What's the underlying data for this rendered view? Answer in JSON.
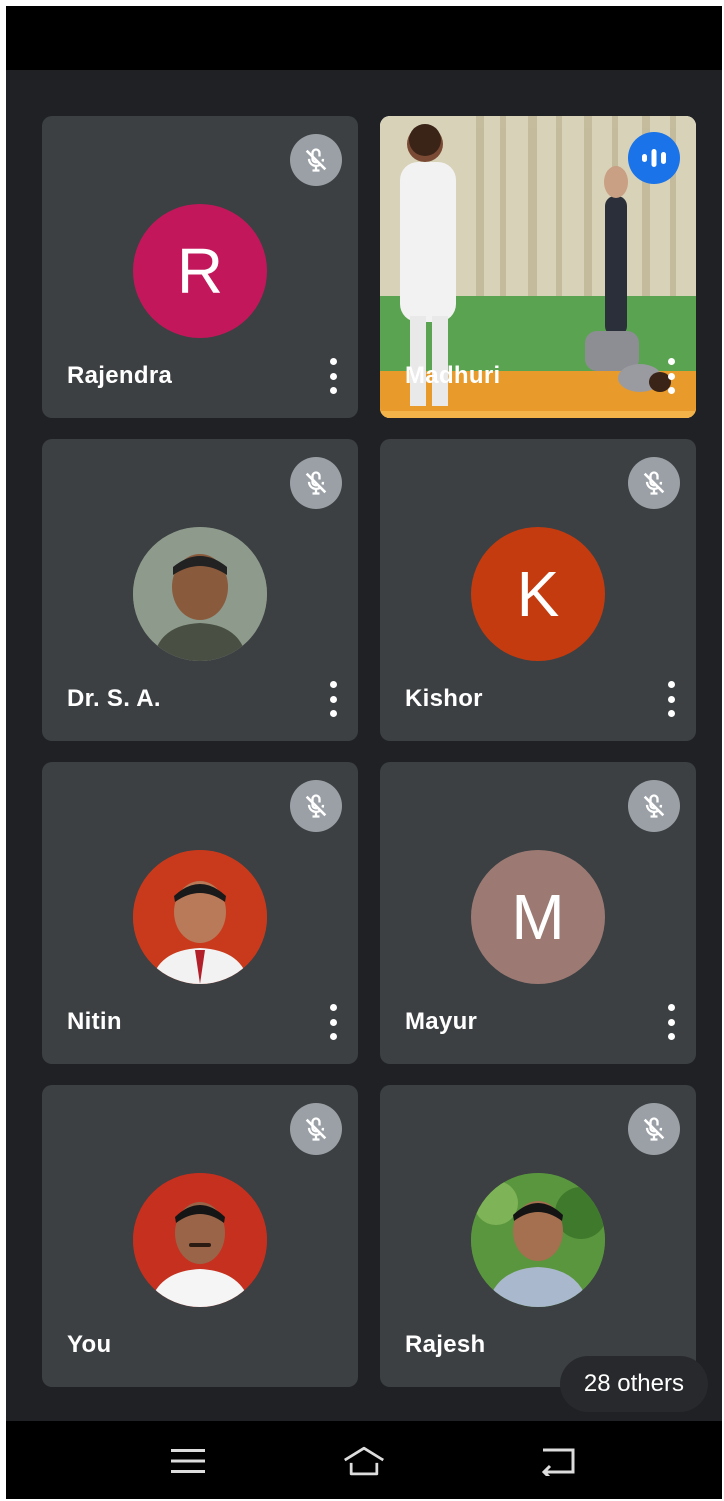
{
  "participants": [
    {
      "name": "Rajendra",
      "initial": "R",
      "color": "#c2185b",
      "muted": true
    },
    {
      "name": "Madhuri",
      "video": true,
      "speaking": true
    },
    {
      "name": "Dr. S. A.",
      "photo": true
    },
    {
      "name": "Kishor",
      "initial": "K",
      "color": "#c43b0f",
      "muted": true
    },
    {
      "name": "Nitin",
      "photo": true
    },
    {
      "name": "Mayur",
      "initial": "M",
      "color": "#9c7a73",
      "muted": true
    },
    {
      "name": "You",
      "photo": true
    },
    {
      "name": "Rajesh",
      "photo": true
    }
  ],
  "others_label": "28 others",
  "icons": {
    "mute": "mic-off-icon",
    "more": "more-vert-icon",
    "speaking": "audio-wave-icon",
    "nav_menu": "menu-icon",
    "nav_home": "home-icon",
    "nav_back": "back-icon"
  },
  "colors": {
    "background": "#202124",
    "tile": "#3c4043",
    "speaking": "#1a73e8"
  }
}
